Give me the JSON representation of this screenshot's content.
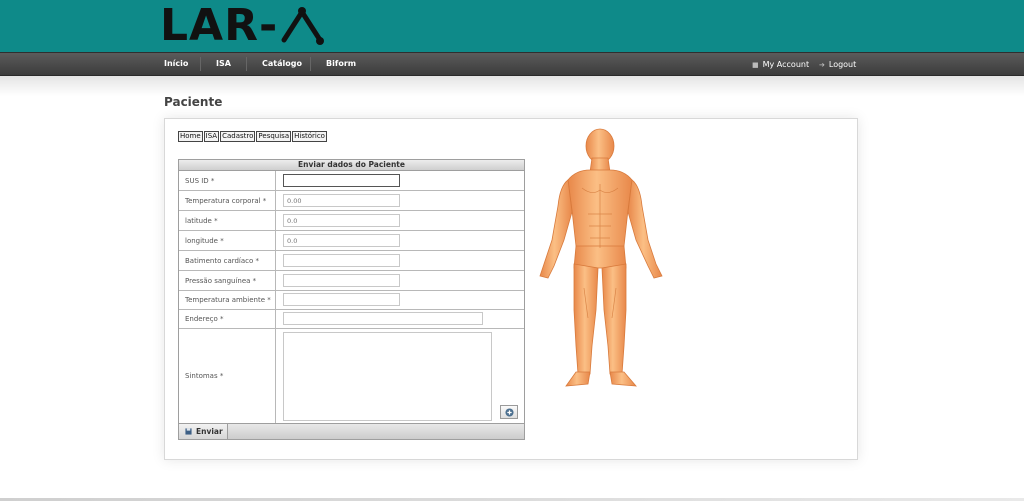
{
  "header": {
    "logo_text": "LAR-",
    "brand_color": "#0e8a89"
  },
  "nav": {
    "items": [
      "Início",
      "ISA",
      "Catálogo",
      "Biform"
    ],
    "account_label": "My Account",
    "logout_label": "Logout"
  },
  "page": {
    "title": "Paciente"
  },
  "links": [
    "Home",
    "ISA",
    "Cadastro",
    "Pesquisa",
    "Histórico"
  ],
  "form": {
    "caption": "Enviar dados do Paciente",
    "fields": [
      {
        "label": "SUS ID *",
        "placeholder": ""
      },
      {
        "label": "Temperatura corporal *",
        "placeholder": "0.00"
      },
      {
        "label": "latitude *",
        "placeholder": "0.0"
      },
      {
        "label": "longitude *",
        "placeholder": "0.0"
      },
      {
        "label": "Batimento cardíaco *",
        "placeholder": ""
      },
      {
        "label": "Pressão sanguínea *",
        "placeholder": ""
      },
      {
        "label": "Temperatura ambiente *",
        "placeholder": ""
      },
      {
        "label": "Endereço *",
        "placeholder": ""
      },
      {
        "label": "Sintomas *",
        "placeholder": ""
      }
    ],
    "submit_label": "Enviar"
  }
}
